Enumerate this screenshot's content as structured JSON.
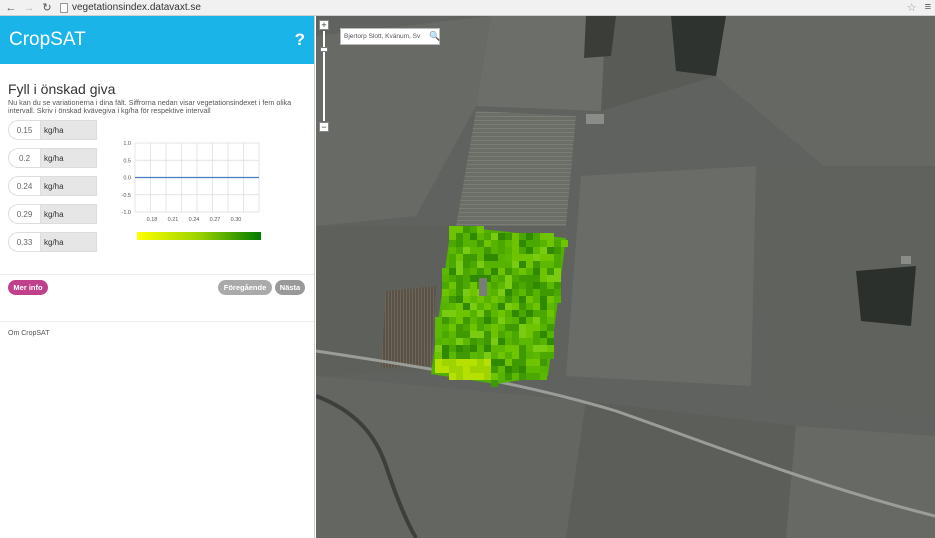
{
  "browser": {
    "url": "vegetationsindex.datavaxt.se",
    "back_icon": "back-arrow-icon",
    "forward_icon": "forward-arrow-icon",
    "reload_icon": "reload-icon"
  },
  "header": {
    "title": "CropSAT",
    "help_label": "?"
  },
  "section": {
    "title": "Fyll i önskad giva",
    "intro": "Nu kan du se variationerna i dina fält. Siffrorna nedan visar vegetationsindexet i fem olika intervall. Skriv i önskad kvävegiva i kg/ha för respektive intervall"
  },
  "rows": [
    {
      "value": "0.15",
      "unit": "kg/ha"
    },
    {
      "value": "0.2",
      "unit": "kg/ha"
    },
    {
      "value": "0.24",
      "unit": "kg/ha"
    },
    {
      "value": "0.29",
      "unit": "kg/ha"
    },
    {
      "value": "0.33",
      "unit": "kg/ha"
    }
  ],
  "chart_data": {
    "type": "line",
    "x_ticks": [
      "0.18",
      "0.21",
      "0.24",
      "0.27",
      "0.30"
    ],
    "y_ticks": [
      "1.0",
      "0.5",
      "0.0",
      "-0.5",
      "-1.0"
    ],
    "ylim": [
      -1.0,
      1.0
    ],
    "grid": true,
    "series": [
      {
        "values": [
          0,
          0,
          0,
          0,
          0,
          0
        ],
        "color": "#4a78c4"
      }
    ],
    "colorbar": [
      "#ffff00",
      "#9bd200",
      "#007a00"
    ]
  },
  "buttons": {
    "info": "Mer info",
    "prev": "Föregående",
    "next": "Nästa"
  },
  "footer": {
    "about": "Om CropSAT"
  },
  "map": {
    "search_value": "Bjertorp Slott, Kvänum, Sv",
    "zoom_in": "+",
    "zoom_out": "−"
  },
  "colors": {
    "accent": "#1ab4e8",
    "info_button": "#c1408c",
    "disabled_button": "#aaaaaa"
  }
}
